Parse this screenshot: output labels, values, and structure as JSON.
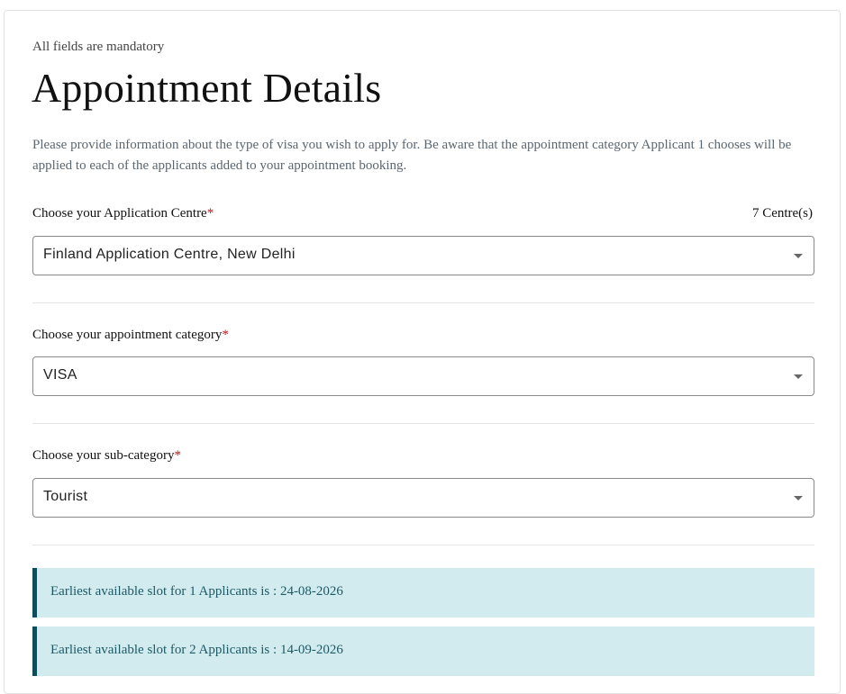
{
  "header": {
    "mandatory_note": "All fields are mandatory",
    "title": "Appointment Details",
    "intro": "Please provide information about the type of visa you wish to apply for. Be aware that the appointment category Applicant 1 chooses will be applied to each of the applicants added to your appointment booking."
  },
  "fields": {
    "centre": {
      "label": "Choose your Application Centre",
      "required_mark": "*",
      "count": "7 Centre(s)",
      "value": "Finland Application Centre, New Delhi"
    },
    "category": {
      "label": "Choose your appointment category",
      "required_mark": "*",
      "value": "VISA"
    },
    "subcategory": {
      "label": "Choose your sub-category",
      "required_mark": "*",
      "value": "Tourist"
    }
  },
  "slots": [
    {
      "text": "Earliest available slot for 1 Applicants is : 24-08-2026"
    },
    {
      "text": "Earliest available slot for 2 Applicants is : 14-09-2026"
    }
  ],
  "colors": {
    "accent_bar": "#0f4c5c",
    "slot_background": "#d1ebef",
    "required": "#c0121f"
  },
  "icons": {
    "select_caret": "chevron-down-icon"
  }
}
